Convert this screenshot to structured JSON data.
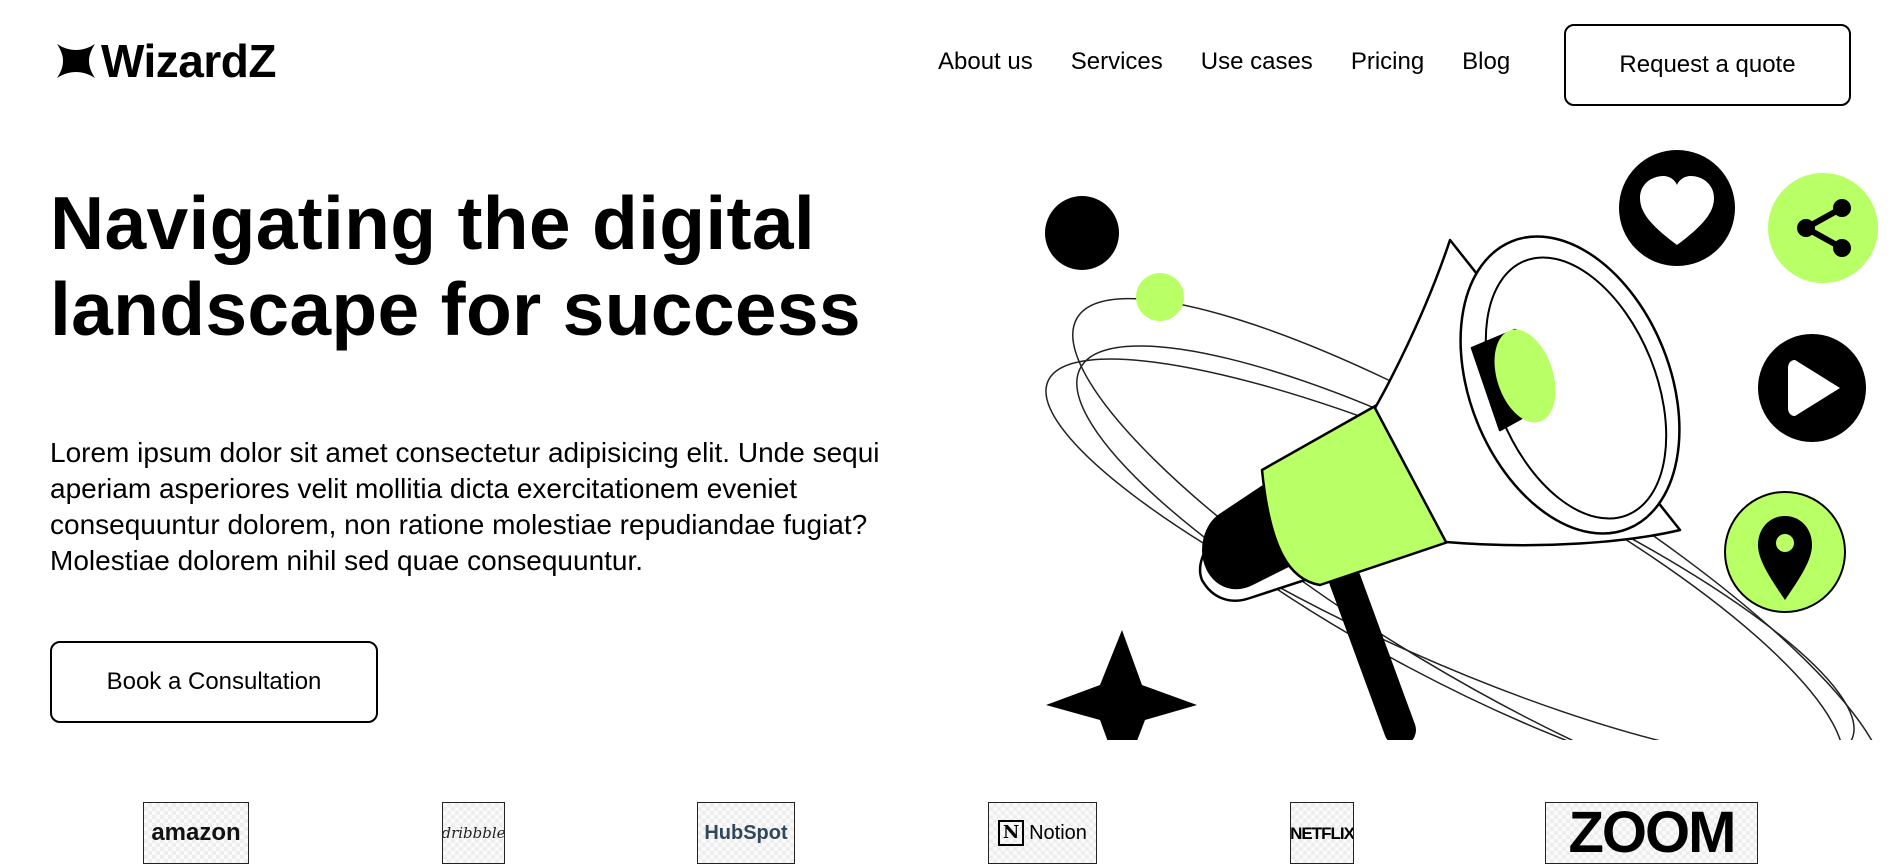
{
  "brand": {
    "name": "WizardZ"
  },
  "nav": {
    "items": [
      "About us",
      "Services",
      "Use cases",
      "Pricing",
      "Blog"
    ],
    "cta": "Request a quote"
  },
  "hero": {
    "headline_line1": "Navigating the digital",
    "headline_line2": "landscape for success",
    "lead": "Lorem ipsum dolor sit amet consectetur adipisicing elit. Unde sequi aperiam asperiores velit mollitia dicta exercitationem eveniet consequuntur dolorem, non ratione molestiae repudiandae fugiat? Molestiae dolorem nihil sed quae consequuntur.",
    "cta": "Book a Consultation"
  },
  "colors": {
    "accent": "#b9ff66",
    "ink": "#000000",
    "background": "#ffffff"
  },
  "illustration": {
    "icons": [
      "megaphone-icon",
      "heart-icon",
      "share-icon",
      "play-icon",
      "location-pin-icon",
      "star-shape-icon"
    ]
  },
  "partners": {
    "amazon": "amazon",
    "dribbble": "dribbble",
    "hubspot": "HubSpot",
    "notion": "Notion",
    "netflix": "NETFLIX",
    "zoom": "ZOOM"
  }
}
